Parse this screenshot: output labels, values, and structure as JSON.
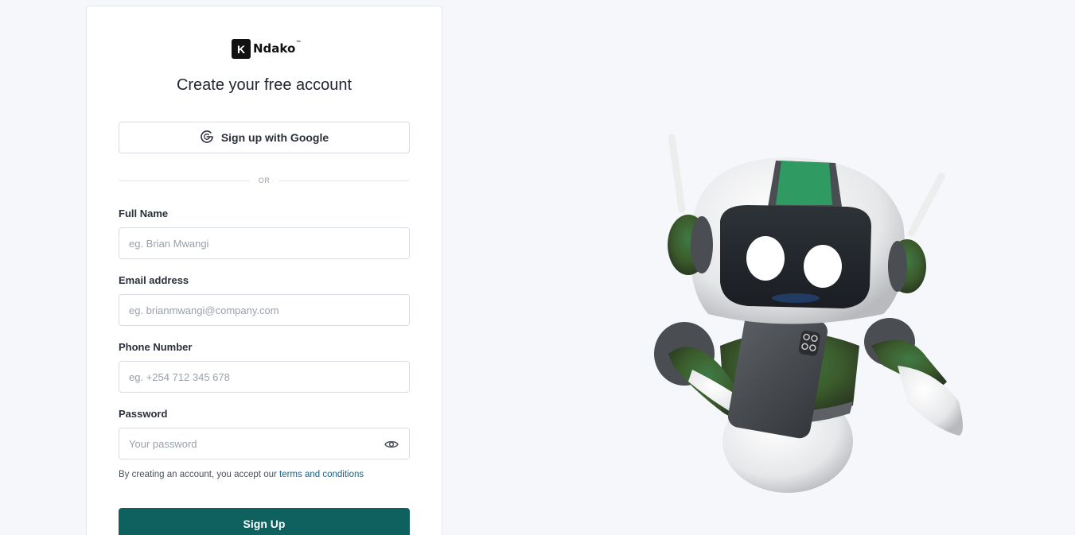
{
  "brand": {
    "logo_letter": "K",
    "logo_text": "Ndako",
    "trademark": "™"
  },
  "form": {
    "title": "Create your free account",
    "google_button_label": "Sign up with Google",
    "divider_text": "OR",
    "full_name": {
      "label": "Full Name",
      "placeholder": "eg. Brian Mwangi",
      "value": ""
    },
    "email": {
      "label": "Email address",
      "placeholder": "eg. brianmwangi@company.com",
      "value": ""
    },
    "phone": {
      "label": "Phone Number",
      "placeholder": "eg. +254 712 345 678",
      "value": ""
    },
    "password": {
      "label": "Password",
      "placeholder": "Your password",
      "value": ""
    },
    "terms_prefix": "By creating an account, you accept our ",
    "terms_link": "terms and conditions",
    "submit_label": "Sign Up"
  },
  "colors": {
    "primary": "#0f6160",
    "link": "#1b5f86",
    "background": "#f6f7fb"
  },
  "icons": {
    "google": "google-g-icon",
    "password_toggle": "eye-icon",
    "illustration": "robot-mascot"
  }
}
